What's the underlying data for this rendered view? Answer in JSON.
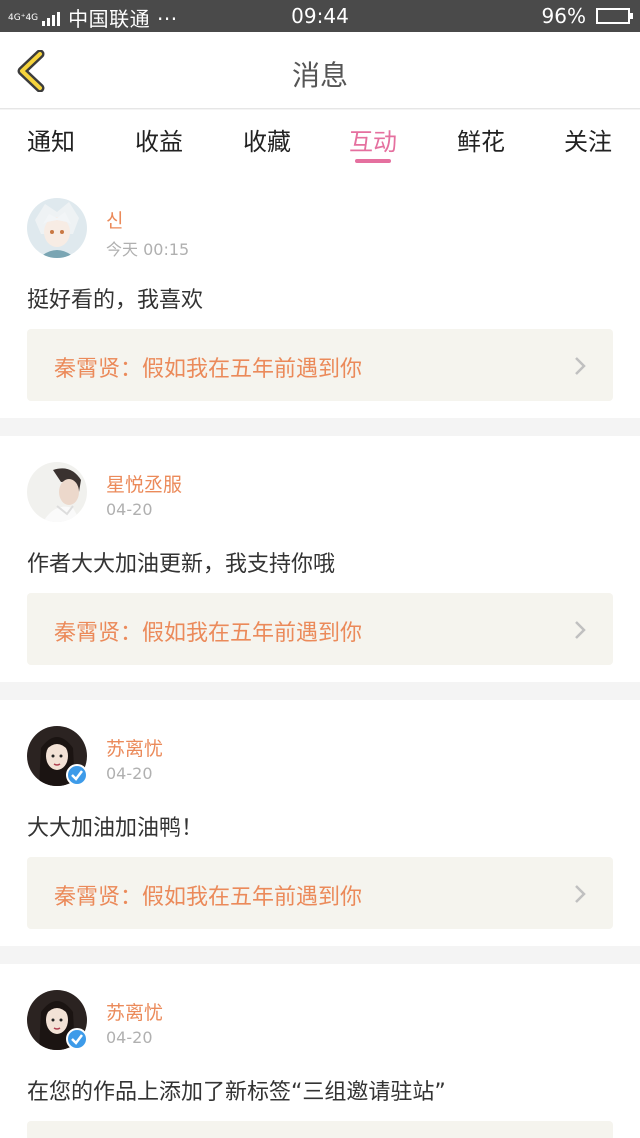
{
  "status_bar": {
    "network": "4G⁺4G",
    "carrier": "中国联通 ···",
    "time": "09:44",
    "battery": "96%",
    "battery_level": 0.96
  },
  "header": {
    "title": "消息"
  },
  "tabs": [
    {
      "label": "通知"
    },
    {
      "label": "收益"
    },
    {
      "label": "收藏"
    },
    {
      "label": "互动",
      "active": true
    },
    {
      "label": "鲜花"
    },
    {
      "label": "关注"
    }
  ],
  "messages": [
    {
      "username": "신",
      "time": "今天 00:15",
      "comment": "挺好看的，我喜欢",
      "ref": "秦霄贤：假如我在五年前遇到你",
      "avatar": "anime-avatar"
    },
    {
      "username": "星悦丞服",
      "time": "04-20",
      "comment": "作者大大加油更新，我支持你哦",
      "ref": "秦霄贤：假如我在五年前遇到你",
      "avatar": "man-avatar"
    },
    {
      "username": "苏离忧",
      "time": "04-20",
      "comment": "大大加油加油鸭！",
      "ref": "秦霄贤：假如我在五年前遇到你",
      "avatar": "woman-avatar",
      "verified": true
    },
    {
      "username": "苏离忧",
      "time": "04-20",
      "comment": "在您的作品上添加了新标签“三组邀请驻站”",
      "ref": "",
      "avatar": "woman-avatar",
      "verified": true
    }
  ],
  "colors": {
    "accent_pink": "#e5709f",
    "username_orange": "#eb8a5a",
    "ref_bg": "#f5f4ee"
  }
}
